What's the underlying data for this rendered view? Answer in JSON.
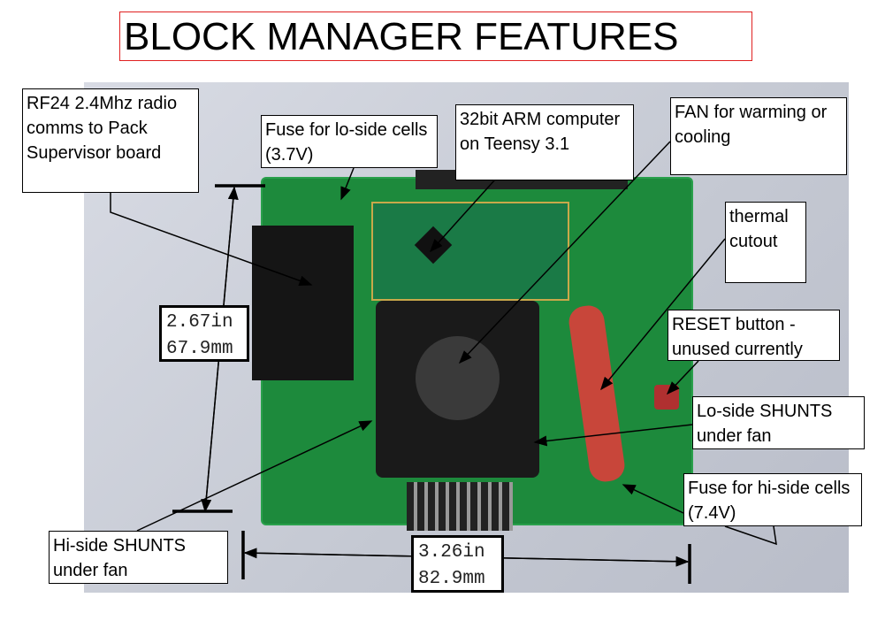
{
  "title": "BLOCK MANAGER FEATURES",
  "labels": {
    "rf24": "RF24 2.4Mhz radio comms to Pack Supervisor board",
    "fuse_lo": "Fuse for lo-side cells (3.7V)",
    "arm": "32bit ARM computer on Teensy 3.1",
    "fan": "FAN for warming or cooling",
    "thermal": "thermal cutout",
    "reset": "RESET button - unused currently",
    "lo_shunts": "Lo-side SHUNTS under fan",
    "fuse_hi": "Fuse for hi-side cells (7.4V)",
    "hi_shunts": "Hi-side SHUNTS under fan"
  },
  "dimensions": {
    "height_in": "2.67in",
    "height_mm": "67.9mm",
    "width_in": "3.26in",
    "width_mm": "82.9mm"
  },
  "colors": {
    "title_border": "#e02020",
    "pcb": "#1d8a3c"
  }
}
